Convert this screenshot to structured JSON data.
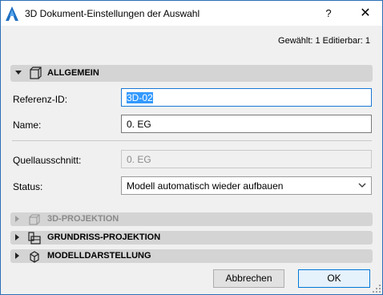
{
  "window": {
    "title": "3D Dokument-Einstellungen der Auswahl",
    "help_label": "?",
    "close_label": "✕"
  },
  "status_line": "Gewählt: 1 Editierbar: 1",
  "sections": {
    "allgemein": "ALLGEMEIN",
    "projektion_3d": "3D-PROJEKTION",
    "grundriss_projektion": "GRUNDRISS-PROJEKTION",
    "modelldarstellung": "MODELLDARSTELLUNG"
  },
  "fields": {
    "referenz_id": {
      "label": "Referenz-ID:",
      "value": "3D-02"
    },
    "name": {
      "label": "Name:",
      "value": "0. EG"
    },
    "quellausschnitt": {
      "label": "Quellausschnitt:",
      "value": "0. EG"
    },
    "status": {
      "label": "Status:",
      "value": "Modell automatisch wieder aufbauen"
    }
  },
  "buttons": {
    "cancel": "Abbrechen",
    "ok": "OK"
  },
  "colors": {
    "accent": "#0078d7",
    "selection": "#3399ff",
    "section_bg": "#d4d4d4",
    "window_bg": "#f0f0f0"
  }
}
